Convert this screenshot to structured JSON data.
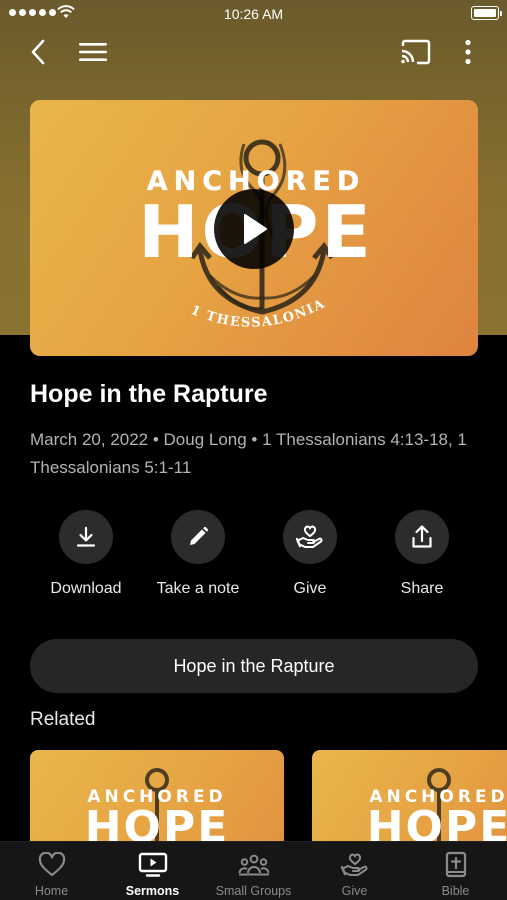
{
  "status_bar": {
    "time": "10:26 AM"
  },
  "nav": {
    "back_icon": "chevron-left-icon",
    "menu_icon": "hamburger-icon",
    "cast_icon": "cast-icon",
    "more_icon": "vertical-dots-icon"
  },
  "artwork": {
    "line1": "ANCHORED",
    "line2": "HOPE",
    "subtitle": "1 THESSALONIANS",
    "play_icon": "play-icon"
  },
  "sermon": {
    "title": "Hope in the Rapture",
    "meta": "March 20, 2022 • Doug Long • 1 Thessalonians 4:13-18, 1 Thessalonians 5:1-11"
  },
  "actions": [
    {
      "label": "Download",
      "icon": "download-icon"
    },
    {
      "label": "Take a note",
      "icon": "pencil-icon"
    },
    {
      "label": "Give",
      "icon": "give-heart-hand-icon"
    },
    {
      "label": "Share",
      "icon": "share-icon"
    }
  ],
  "pill_button": {
    "label": "Hope in the Rapture"
  },
  "related": {
    "heading": "Related",
    "card_line1": "ANCHORED",
    "card_line2": "HOPE"
  },
  "tabs": [
    {
      "label": "Home",
      "icon": "heart-icon",
      "active": false
    },
    {
      "label": "Sermons",
      "icon": "tv-play-icon",
      "active": true
    },
    {
      "label": "Small Groups",
      "icon": "group-icon",
      "active": false
    },
    {
      "label": "Give",
      "icon": "give-heart-hand-icon",
      "active": false
    },
    {
      "label": "Bible",
      "icon": "bible-icon",
      "active": false
    }
  ],
  "colors": {
    "header_gold": "#87702f",
    "art_orange": "#e6a343",
    "background": "#000000",
    "button_dark": "#2c2c2c"
  }
}
